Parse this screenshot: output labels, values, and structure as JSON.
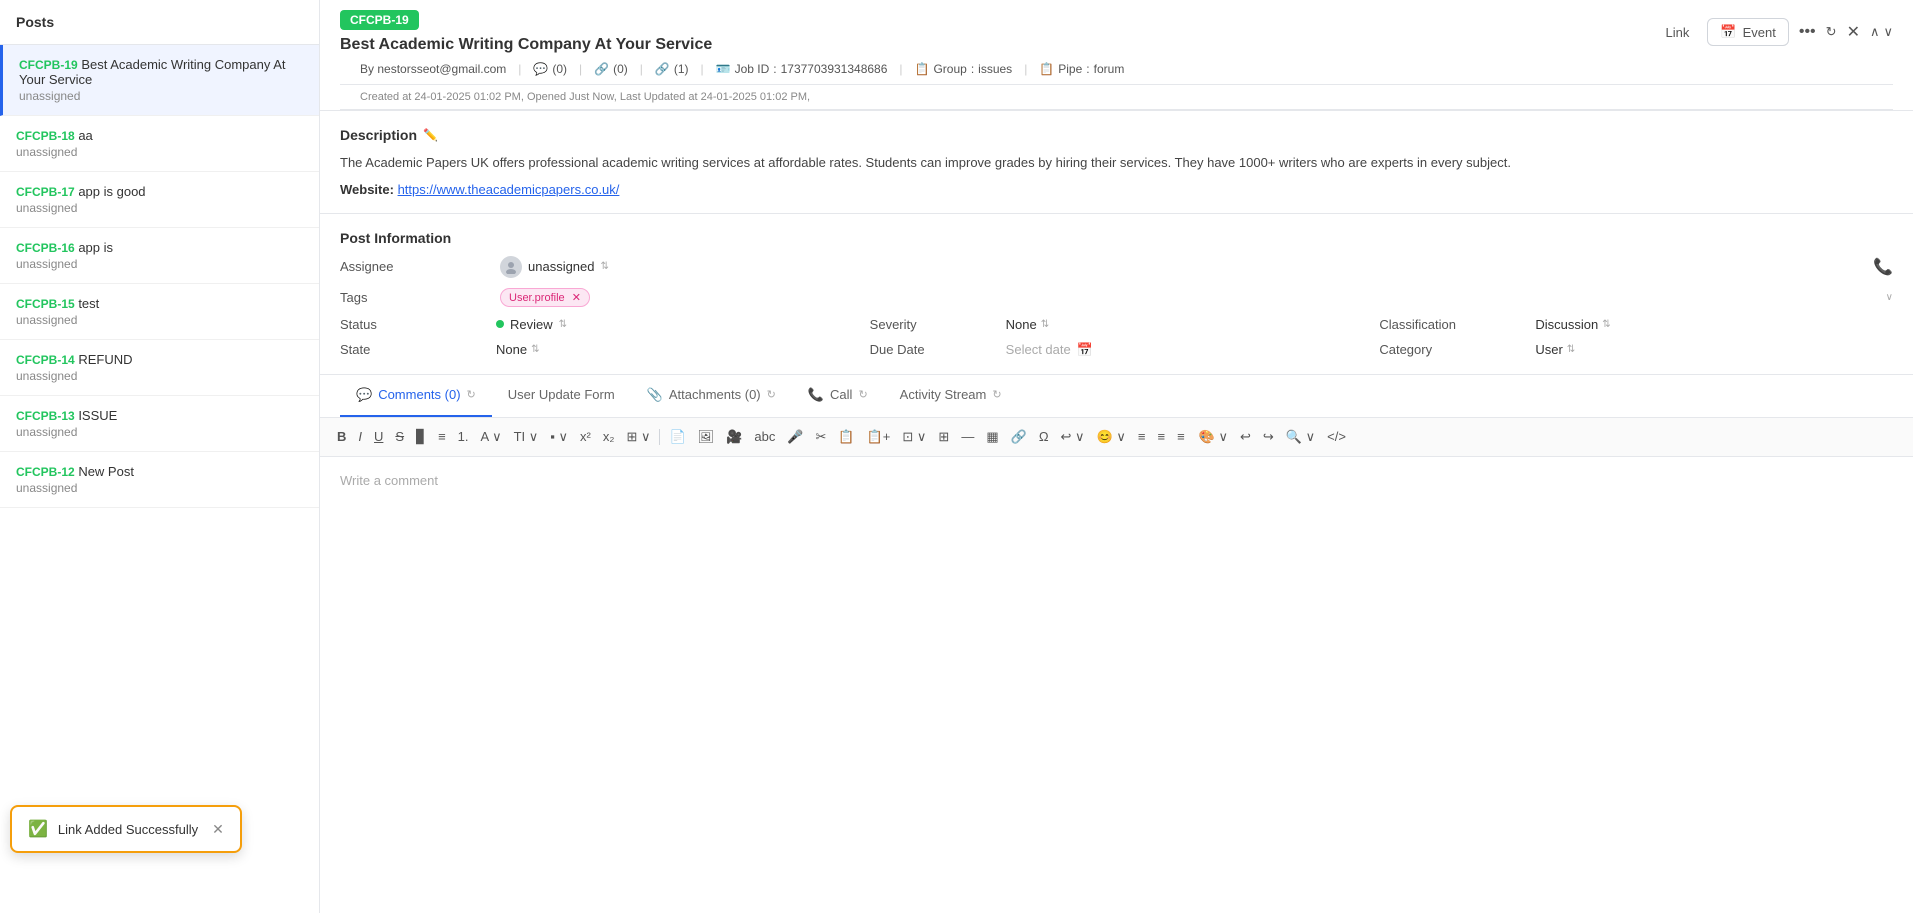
{
  "sidebar": {
    "header": "Posts",
    "items": [
      {
        "id": "CFCPB-19",
        "title": "Best Academic Writing Company At Your Service",
        "status": "unassigned",
        "active": true
      },
      {
        "id": "CFCPB-18",
        "title": "aa",
        "status": "unassigned",
        "active": false
      },
      {
        "id": "CFCPB-17",
        "title": "app is good",
        "status": "unassigned",
        "active": false
      },
      {
        "id": "CFCPB-16",
        "title": "app is",
        "status": "unassigned",
        "active": false
      },
      {
        "id": "CFCPB-15",
        "title": "test",
        "status": "unassigned",
        "active": false
      },
      {
        "id": "CFCPB-14",
        "title": "REFUND",
        "status": "unassigned",
        "active": false
      },
      {
        "id": "CFCPB-13",
        "title": "ISSUE",
        "status": "unassigned",
        "active": false
      },
      {
        "id": "CFCPB-12",
        "title": "New Post",
        "status": "unassigned",
        "active": false
      }
    ]
  },
  "toast": {
    "text": "Link Added Successfully",
    "close_label": "✕"
  },
  "main": {
    "badge": "CFCPB-19",
    "title": "Best Academic Writing Company At Your Service",
    "actions": {
      "link_label": "Link",
      "event_label": "Event"
    },
    "meta": {
      "email": "nestorsseot@gmail.com",
      "comments_count": "(0)",
      "links_count": "(0)",
      "links_active_count": "(1)",
      "job_id_label": "Job ID",
      "job_id_value": "1737703931348686",
      "group_label": "Group",
      "group_value": "issues",
      "pipe_label": "Pipe",
      "pipe_value": "forum"
    },
    "timestamps": "Created at 24-01-2025 01:02 PM,  Opened Just Now,  Last Updated at 24-01-2025 01:02 PM,",
    "description": {
      "title": "Description",
      "text": "The Academic Papers UK offers professional academic writing services at affordable rates. Students can improve grades by hiring their services. They have 1000+ writers who are experts in every subject.",
      "website_label": "Website:",
      "website_url": "https://www.theacademicpapers.co.uk/",
      "website_text": "https://www.theacademicpapers.co.uk/"
    },
    "post_info": {
      "title": "Post Information",
      "assignee_label": "Assignee",
      "assignee_value": "unassigned",
      "tags_label": "Tags",
      "tag_value": "User.profile",
      "status_label": "Status",
      "status_value": "Review",
      "severity_label": "Severity",
      "severity_value": "None",
      "classification_label": "Classification",
      "classification_value": "Discussion",
      "state_label": "State",
      "state_value": "None",
      "due_date_label": "Due Date",
      "due_date_placeholder": "Select date",
      "category_label": "Category",
      "category_value": "User"
    },
    "tabs": [
      {
        "label": "Comments (0)",
        "active": true
      },
      {
        "label": "User Update Form",
        "active": false
      },
      {
        "label": "Attachments (0)",
        "active": false
      },
      {
        "label": "Call",
        "active": false
      },
      {
        "label": "Activity Stream",
        "active": false
      }
    ],
    "editor": {
      "placeholder": "Write a comment"
    }
  }
}
